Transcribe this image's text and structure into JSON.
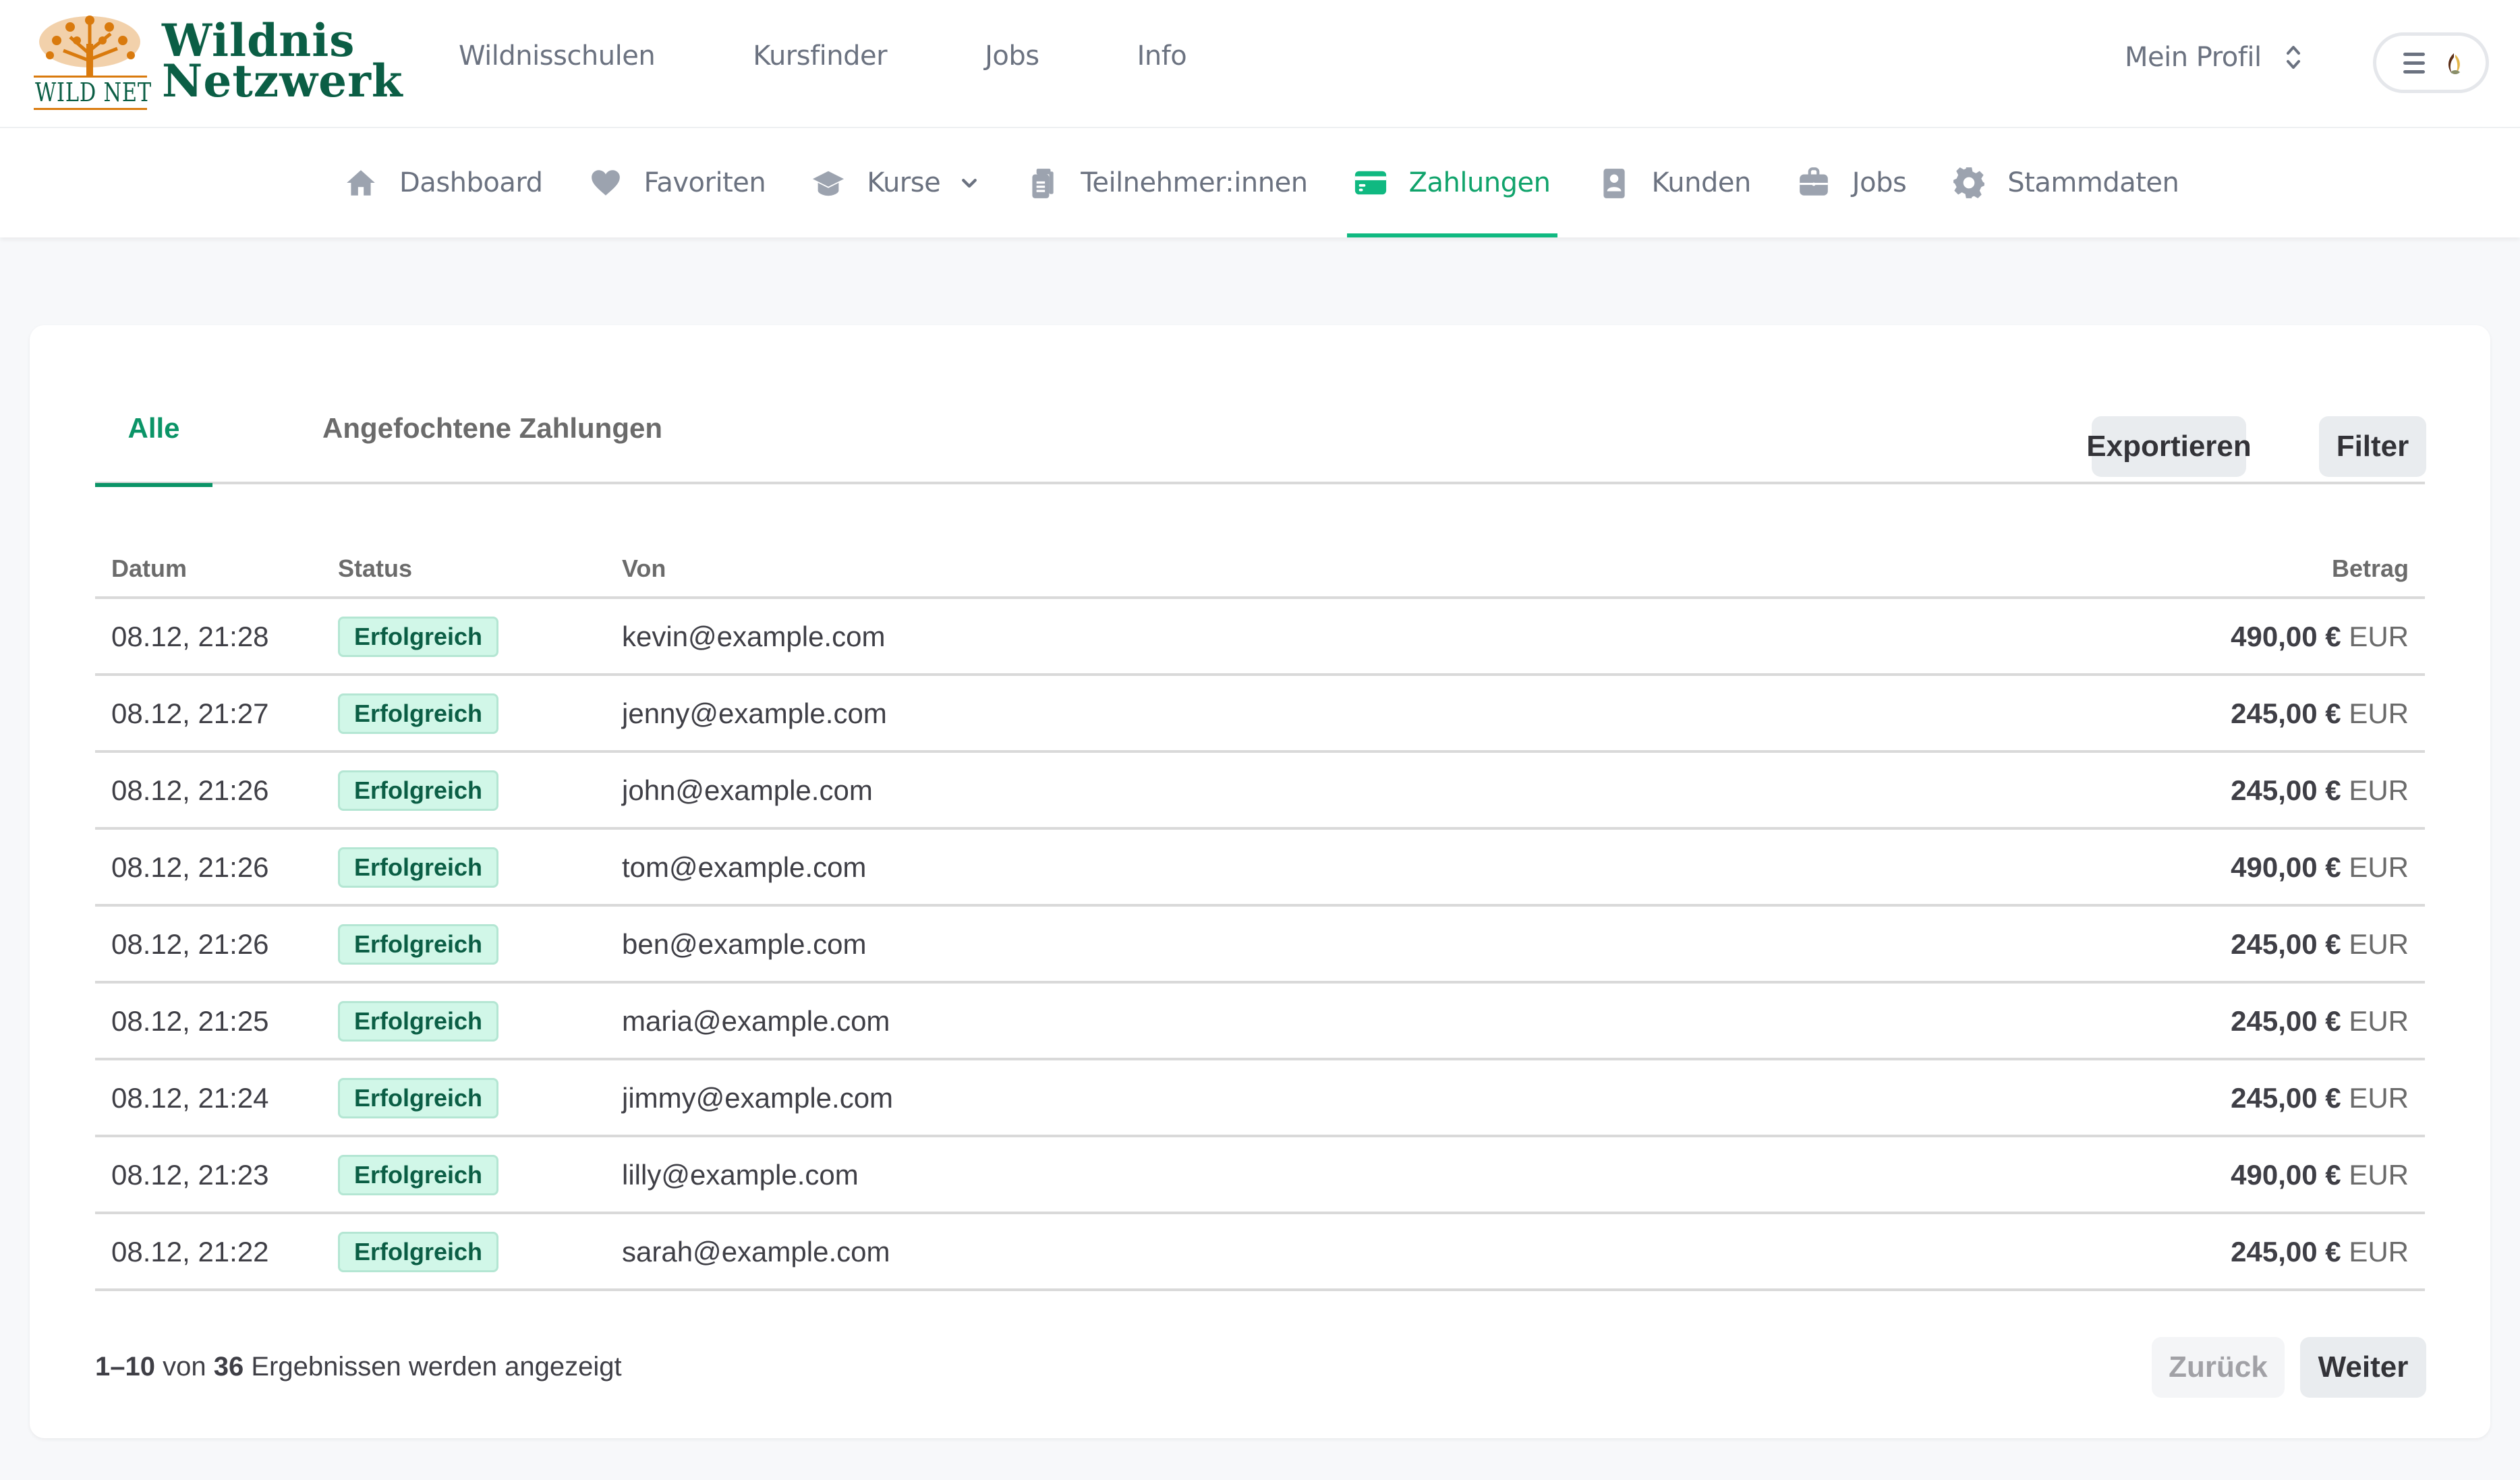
{
  "brand": {
    "name_line1": "Wildnis",
    "name_line2": "Netzwerk",
    "mark_text": "WILD NET",
    "primary_color": "#0b5e45",
    "accent_color": "#10b981",
    "logo_color": "#d97a0d"
  },
  "topnav": {
    "items": [
      {
        "label": "Wildnisschulen"
      },
      {
        "label": "Kursfinder"
      },
      {
        "label": "Jobs"
      },
      {
        "label": "Info"
      }
    ],
    "profile_label": "Mein Profil",
    "profile_icon": "chevron-up-down-icon",
    "menu_icon": "hamburger-icon",
    "avatar_icon": "user-avatar"
  },
  "subnav": {
    "items": [
      {
        "label": "Dashboard",
        "icon": "home-icon"
      },
      {
        "label": "Favoriten",
        "icon": "heart-icon"
      },
      {
        "label": "Kurse",
        "icon": "graduation-cap-icon",
        "has_dropdown": true
      },
      {
        "label": "Teilnehmer:innen",
        "icon": "clipboard-icon"
      },
      {
        "label": "Zahlungen",
        "icon": "credit-card-icon",
        "active": true
      },
      {
        "label": "Kunden",
        "icon": "contact-book-icon"
      },
      {
        "label": "Jobs",
        "icon": "briefcase-icon"
      },
      {
        "label": "Stammdaten",
        "icon": "gear-icon"
      }
    ]
  },
  "payments": {
    "tabs": [
      {
        "label": "Alle",
        "active": true
      },
      {
        "label": "Angefochtene Zahlungen",
        "active": false
      }
    ],
    "export_label": "Exportieren",
    "filter_label": "Filter",
    "columns": {
      "date": "Datum",
      "status": "Status",
      "from": "Von",
      "amount": "Betrag"
    },
    "rows": [
      {
        "date": "08.12, 21:28",
        "status": "Erfolgreich",
        "from": "kevin@example.com",
        "amount": "490,00 €",
        "currency": "EUR"
      },
      {
        "date": "08.12, 21:27",
        "status": "Erfolgreich",
        "from": "jenny@example.com",
        "amount": "245,00 €",
        "currency": "EUR"
      },
      {
        "date": "08.12, 21:26",
        "status": "Erfolgreich",
        "from": "john@example.com",
        "amount": "245,00 €",
        "currency": "EUR"
      },
      {
        "date": "08.12, 21:26",
        "status": "Erfolgreich",
        "from": "tom@example.com",
        "amount": "490,00 €",
        "currency": "EUR"
      },
      {
        "date": "08.12, 21:26",
        "status": "Erfolgreich",
        "from": "ben@example.com",
        "amount": "245,00 €",
        "currency": "EUR"
      },
      {
        "date": "08.12, 21:25",
        "status": "Erfolgreich",
        "from": "maria@example.com",
        "amount": "245,00 €",
        "currency": "EUR"
      },
      {
        "date": "08.12, 21:24",
        "status": "Erfolgreich",
        "from": "jimmy@example.com",
        "amount": "245,00 €",
        "currency": "EUR"
      },
      {
        "date": "08.12, 21:23",
        "status": "Erfolgreich",
        "from": "lilly@example.com",
        "amount": "490,00 €",
        "currency": "EUR"
      },
      {
        "date": "08.12, 21:22",
        "status": "Erfolgreich",
        "from": "sarah@example.com",
        "amount": "245,00 €",
        "currency": "EUR"
      }
    ],
    "pagination": {
      "range": "1–10",
      "of_label": "von",
      "total": "36",
      "suffix": "Ergebnissen werden angezeigt",
      "prev_label": "Zurück",
      "next_label": "Weiter",
      "prev_disabled": true
    },
    "status_colors": {
      "success_bg": "#d1f7e8",
      "success_text": "#0b5e45"
    }
  }
}
